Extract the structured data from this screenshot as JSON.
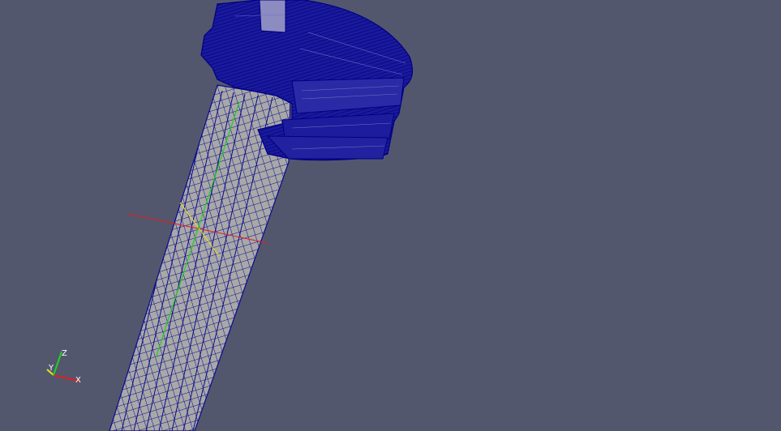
{
  "viewport": {
    "background": "#52576e",
    "mesh_color": "#0a0a8c",
    "surface_color": "#a8a8a8"
  },
  "orientation_axes": {
    "x_label": "X",
    "y_label": "Y",
    "z_label": "Z",
    "x_color": "#e02020",
    "y_color": "#e8e020",
    "z_color": "#20d020"
  },
  "center_axes": {
    "x_color": "#e02020",
    "y_color": "#e8e020",
    "z_color": "#20d020"
  },
  "icons": {
    "orientation": "orientation-axes-icon",
    "center": "center-of-rotation-icon"
  }
}
